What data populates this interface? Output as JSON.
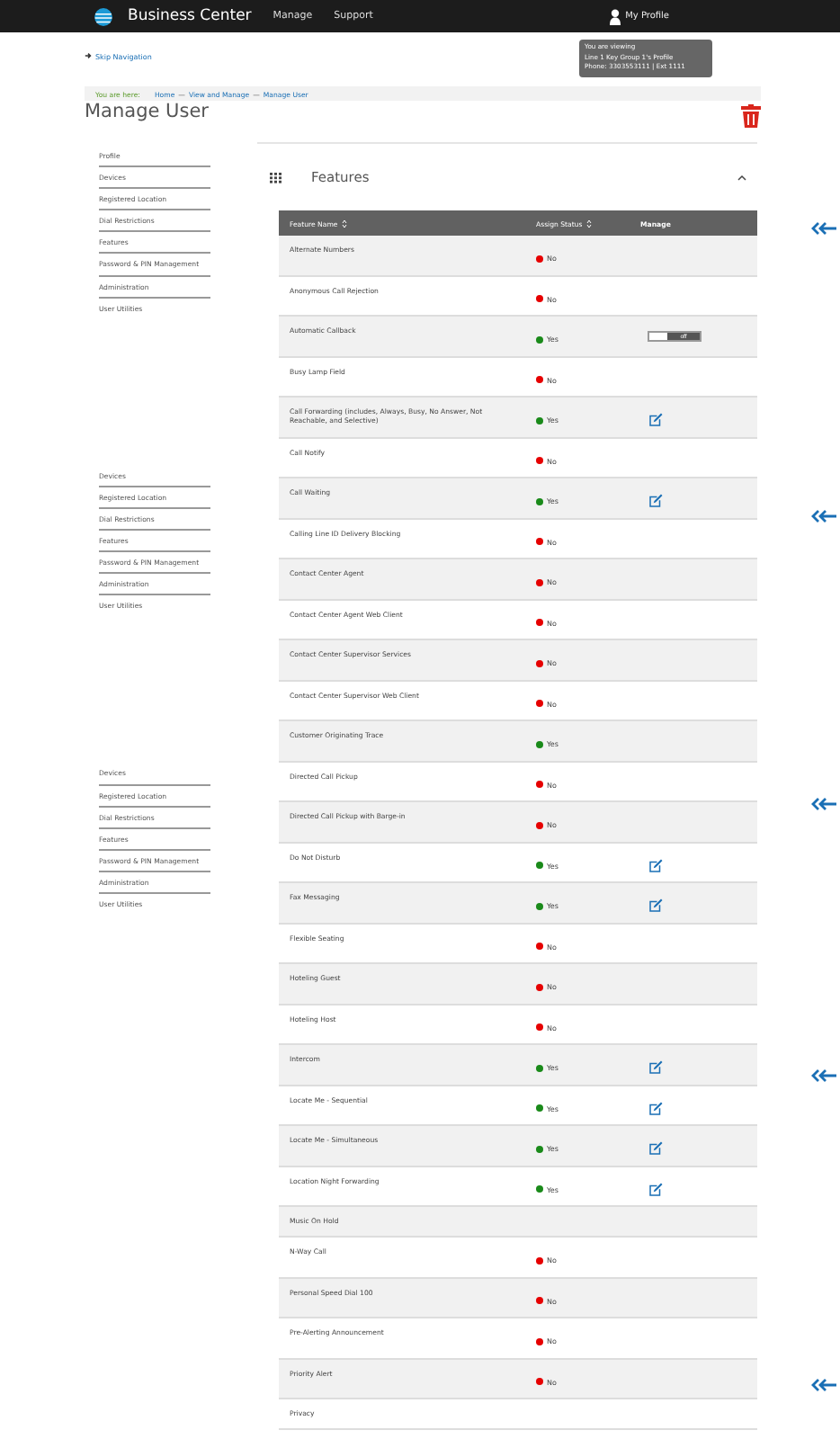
{
  "header": {
    "brand": "Business Center",
    "menu": [
      "Manage",
      "Support"
    ],
    "profile": "My Profile"
  },
  "tooltip": {
    "lines": [
      "You are viewing",
      "Line 1 Key Group 1's Profile",
      "Phone: 3303553111 | Ext 1111"
    ]
  },
  "skip_link": "Skip Navigation",
  "breadcrumb": {
    "label": "You are here:",
    "items": [
      "Home",
      "View and Manage",
      "Manage User"
    ],
    "separator": "—"
  },
  "title": "Manage User",
  "side_nav": [
    {
      "items": [
        "Profile",
        "Devices",
        "Registered Location",
        "Dial Restrictions",
        "Features",
        "Password & PIN Management",
        "Administration",
        "User Utilities"
      ]
    },
    {
      "items": [
        "Devices",
        "Registered Location",
        "Dial Restrictions",
        "Features",
        "Password & PIN Management",
        "Administration",
        "User Utilities"
      ]
    },
    {
      "items": [
        "Devices",
        "Registered Location",
        "Dial Restrictions",
        "Features",
        "Password & PIN Management",
        "Administration",
        "User Utilities"
      ]
    }
  ],
  "panel": {
    "title": "Features",
    "expanded": true
  },
  "table": {
    "columns": [
      "Feature Name",
      "Assign Status",
      "Manage"
    ],
    "rows": [
      {
        "name": "Alternate Numbers",
        "status": "No",
        "color": "#e60000"
      },
      {
        "name": "Anonymous Call Rejection",
        "status": "No",
        "color": "#e60000"
      },
      {
        "name": "Automatic Callback",
        "status": "Yes",
        "color": "#1a8a1a",
        "kind": "toggle",
        "toggle_label": "off",
        "on": false
      },
      {
        "name": "Busy Lamp Field",
        "status": "No",
        "color": "#e60000"
      },
      {
        "name": "Call Forwarding (includes, Always, Busy, No Answer, Not Reachable, and Selective)",
        "status": "Yes",
        "color": "#1a8a1a",
        "kind": "edit"
      },
      {
        "name": "Call Notify",
        "status": "No",
        "color": "#e60000"
      },
      {
        "name": "Call Waiting",
        "status": "Yes",
        "color": "#1a8a1a",
        "kind": "edit"
      },
      {
        "name": "Calling Line ID Delivery Blocking",
        "status": "No",
        "color": "#e60000"
      },
      {
        "name": "Contact Center Agent",
        "status": "No",
        "color": "#e60000"
      },
      {
        "name": "Contact Center Agent Web Client",
        "status": "No",
        "color": "#e60000"
      },
      {
        "name": "Contact Center Supervisor Services",
        "status": "No",
        "color": "#e60000"
      },
      {
        "name": "Contact Center Supervisor Web Client",
        "status": "No",
        "color": "#e60000"
      },
      {
        "name": "Customer Originating Trace",
        "status": "Yes",
        "color": "#1a8a1a"
      },
      {
        "name": "Directed Call Pickup",
        "status": "No",
        "color": "#e60000"
      },
      {
        "name": "Directed Call Pickup with Barge-in",
        "status": "No",
        "color": "#e60000"
      },
      {
        "name": "Do Not Disturb",
        "status": "Yes",
        "color": "#1a8a1a",
        "kind": "edit"
      },
      {
        "name": "Fax Messaging",
        "status": "Yes",
        "color": "#1a8a1a",
        "kind": "edit"
      },
      {
        "name": "Flexible Seating",
        "status": "No",
        "color": "#e60000"
      },
      {
        "name": "Hoteling Guest",
        "status": "No",
        "color": "#e60000"
      },
      {
        "name": "Hoteling Host",
        "status": "No",
        "color": "#e60000"
      },
      {
        "name": "Intercom",
        "status": "Yes",
        "color": "#1a8a1a",
        "kind": "edit"
      },
      {
        "name": "Locate Me - Sequential",
        "status": "Yes",
        "color": "#1a8a1a",
        "kind": "edit"
      },
      {
        "name": "Locate Me - Simultaneous",
        "status": "Yes",
        "color": "#1a8a1a",
        "kind": "edit"
      },
      {
        "name": "Location Night Forwarding",
        "status": "Yes",
        "color": "#1a8a1a",
        "kind": "edit"
      },
      {
        "name": "Music On Hold"
      },
      {
        "name": "N-Way Call",
        "status": "No",
        "color": "#e60000"
      },
      {
        "name": "Personal Speed Dial 100",
        "status": "No",
        "color": "#e60000"
      },
      {
        "name": "Pre-Alerting Announcement",
        "status": "No",
        "color": "#e60000"
      },
      {
        "name": "Priority Alert",
        "status": "No",
        "color": "#e60000"
      },
      {
        "name": "Privacy"
      }
    ]
  }
}
